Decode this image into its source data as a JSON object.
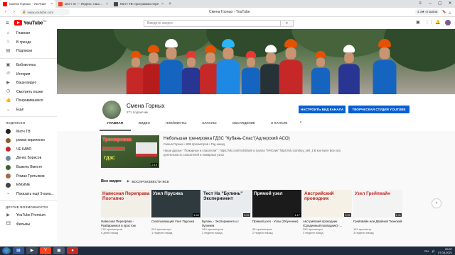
{
  "browser": {
    "tabs": [
      {
        "title": "Смена Горных - YouTube",
        "active": true,
        "favicon_color": "#ff0000"
      },
      {
        "title": "матч тв — Яндекс: нашлось",
        "active": false,
        "favicon_color": "#fc3f1d"
      },
      {
        "title": "Матч ТВ: программа пере",
        "active": false,
        "favicon_color": "#444444"
      }
    ],
    "window_title": "Смена Горных - YouTube",
    "url": "www.youtube.com",
    "rating": "4.3★ отзывов",
    "back_icon": "back-arrow-icon",
    "forward_icon": "forward-arrow-icon"
  },
  "youtube": {
    "logo_text": "YouTube",
    "logo_region": "RU",
    "search_placeholder": "Введите запрос",
    "sidebar": {
      "main_items": [
        {
          "label": "Главная",
          "icon": "home-icon",
          "glyph": "⌂"
        },
        {
          "label": "В тренде",
          "icon": "trending-icon",
          "glyph": "♨"
        },
        {
          "label": "Подписки",
          "icon": "subscriptions-icon",
          "glyph": "▤"
        }
      ],
      "library_items": [
        {
          "label": "Библиотека",
          "icon": "library-icon",
          "glyph": "▣"
        },
        {
          "label": "История",
          "icon": "history-icon",
          "glyph": "↺"
        },
        {
          "label": "Ваши видео",
          "icon": "your-videos-icon",
          "glyph": "▶"
        },
        {
          "label": "Смотреть позже",
          "icon": "watch-later-icon",
          "glyph": "◷"
        },
        {
          "label": "Понравившиеся",
          "icon": "like-icon",
          "glyph": "👍"
        },
        {
          "label": "Ещё",
          "icon": "chevron-down-icon",
          "glyph": "⌄"
        }
      ],
      "subs_header": "ПОДПИСКИ",
      "subscriptions": [
        {
          "label": "Матч ТВ",
          "color": "#222222"
        },
        {
          "label": "роман кириленко",
          "color": "#8b5a2b"
        },
        {
          "label": "ЧЕ КАВО",
          "color": "#c62828"
        },
        {
          "label": "Денис Борисов",
          "color": "#6d8a9c"
        },
        {
          "label": "Выжить Вместе",
          "color": "#3e5f2f"
        },
        {
          "label": "Роман Третьяков",
          "color": "#9e6b4a"
        },
        {
          "label": "ENGINE",
          "color": "#444444"
        },
        {
          "label": "Показать ещё 9 кана...",
          "color": "#ffffff"
        }
      ],
      "other_header": "ДРУГИЕ ВОЗМОЖНОСТИ",
      "other_items": [
        {
          "label": "YouTube Premium",
          "icon": "youtube-premium-icon",
          "glyph": "▶"
        },
        {
          "label": "Фильмы",
          "icon": "movies-icon",
          "glyph": "🎞"
        }
      ]
    },
    "channel": {
      "name": "Смена Горных",
      "subscribers": "271 подписчик",
      "customize_label": "НАСТРОИТЬ ВИД КАНАЛА",
      "studio_label": "ТВОРЧЕСКАЯ СТУДИЯ YOUTUBE",
      "tabs": [
        "ГЛАВНАЯ",
        "ВИДЕО",
        "ПЛЕЙЛИСТЫ",
        "КАНАЛЫ",
        "ОБСУЖДЕНИЕ",
        "О КАНАЛЕ"
      ],
      "active_tab": "ГЛАВНАЯ"
    },
    "featured": {
      "thumb_line1": "Тренировка",
      "thumb_line2": "Спасатели",
      "thumb_line3": "ГДЗС",
      "duration": "2:19",
      "title": "Небольшая тренировка ГДЗС \"Кубань-Спас\"(Адлерский АСО)",
      "meta": "Смена Горных • 699 просмотров • Год назад",
      "description": "Наши друзья- \"Пожарные и спасатели\" : https://vk.com/mchsfamil и группа \"МЧСник\" https://vk.com/buy_sell_1 В контакте Все про деятельность спасателей и пожарных узлы"
    },
    "all_videos": {
      "heading": "Все видео",
      "play_all": "ВОСПРОИЗВЕСТИ ВСЕ"
    },
    "videos": [
      {
        "thumb": "Навесная Переправа Поэтапно",
        "duration": "",
        "title": "Навесная Переправа - Разбираемся в простом",
        "views": "176 просмотров",
        "age": "6 дней назад",
        "bg": "#f2efe6",
        "fg": "#b71c1c"
      },
      {
        "thumb": "Узел Прусика",
        "duration": "1:42",
        "title": "Схватывающий Узел Прусика",
        "views": "242 просмотра",
        "age": "1 неделю назад",
        "bg": "#2f3a3f",
        "fg": "#ffffff"
      },
      {
        "thumb": "Тест На \"Булинь\" Эксперимент",
        "duration": "5:51",
        "title": "Булинь - Эксперименты с булинем",
        "views": "240 просмотров",
        "age": "2 недели назад",
        "bg": "#e9ecef",
        "fg": "#111111"
      },
      {
        "thumb": "Прямой узел",
        "duration": "1:17",
        "title": "Прямой узел - Узлы (Обучение)",
        "views": "95 просмотров",
        "age": "2 недели назад",
        "bg": "#1b1b1b",
        "fg": "#ffffff"
      },
      {
        "thumb": "Австрийский проводник",
        "duration": "0:51",
        "title": "Австрийский проводник (Срединный проводник) -...",
        "views": "252 просмотра",
        "age": "3 недели назад",
        "bg": "#f5f1e6",
        "fg": "#b71c1c"
      },
      {
        "thumb": "Узел Грейпвайн",
        "duration": "1:11",
        "title": "Грейпвайн или Двойной Тканский",
        "views": "191 просмотр",
        "age": "3 недели назад",
        "bg": "#f3f3f3",
        "fg": "#c62828"
      }
    ]
  },
  "taskbar": {
    "language": "RU",
    "time": "20:37",
    "date": "07.03.2021"
  },
  "colors": {
    "youtube_red": "#ff0000",
    "button_blue": "#065fd4",
    "taskbar": "#1f2c3d"
  }
}
